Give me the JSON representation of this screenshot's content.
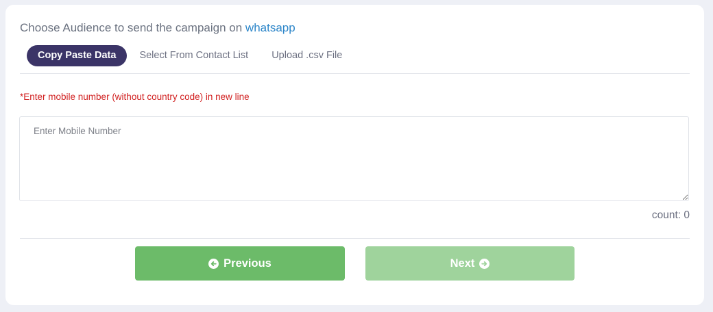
{
  "heading": {
    "prefix": "Choose Audience to send the campaign on",
    "channel": "whatsapp"
  },
  "tabs": [
    {
      "label": "Copy Paste Data",
      "active": true
    },
    {
      "label": "Select From Contact List",
      "active": false
    },
    {
      "label": "Upload .csv File",
      "active": false
    }
  ],
  "hint": "*Enter mobile number (without country code) in new line",
  "numbers_input": {
    "placeholder": "Enter Mobile Number",
    "value": ""
  },
  "count": {
    "label": "count:",
    "value": "0"
  },
  "buttons": {
    "previous": {
      "label": "Previous",
      "icon": "arrow-circle-left-icon"
    },
    "next": {
      "label": "Next",
      "icon": "arrow-circle-right-icon",
      "disabled": true
    }
  },
  "colors": {
    "active_tab": "#3b3467",
    "channel_link": "#2d86c9",
    "hint_text": "#d11f1f",
    "previous_button": "#6cbb69",
    "next_button_disabled": "#9fd39c"
  }
}
